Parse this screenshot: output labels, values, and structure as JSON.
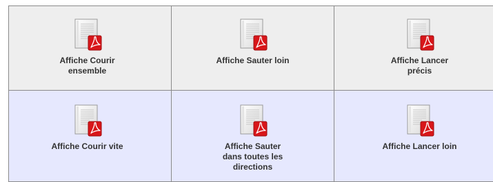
{
  "cells": [
    {
      "label": "Affiche Courir\nensemble",
      "icon": "pdf-document-icon"
    },
    {
      "label": "Affiche Sauter loin",
      "icon": "pdf-document-icon"
    },
    {
      "label": "Affiche Lancer\nprécis",
      "icon": "pdf-document-icon"
    },
    {
      "label": "Affiche Courir vite",
      "icon": "pdf-document-icon"
    },
    {
      "label": "Affiche Sauter\ndans toutes les\ndirections",
      "icon": "pdf-document-icon"
    },
    {
      "label": "Affiche Lancer loin",
      "icon": "pdf-document-icon"
    }
  ],
  "colors": {
    "row1_bg": "#eeeeee",
    "row2_bg": "#e6e8fe",
    "pdf_badge": "#d8161a",
    "border": "#8a8a8a"
  }
}
